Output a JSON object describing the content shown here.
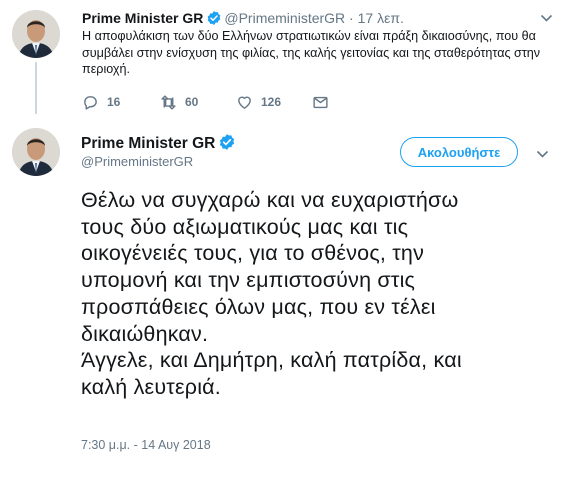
{
  "parent_tweet": {
    "author_name": "Prime Minister GR",
    "handle": "@PrimeministerGR",
    "separator": "·",
    "time": "17 λεπ.",
    "text": "Η αποφυλάκιση των δύο Ελλήνων στρατιωτικών είναι πράξη δικαιοσύνης, που θα συμβάλει στην ενίσχυση της φιλίας, της καλής γειτονίας και της σταθερότητας στην περιοχή.",
    "actions": {
      "reply_count": "16",
      "retweet_count": "60",
      "like_count": "126"
    },
    "icons": [
      "reply-icon",
      "retweet-icon",
      "heart-icon",
      "envelope-icon",
      "chevron-down-icon",
      "verified-badge-icon"
    ]
  },
  "main_tweet": {
    "author_name": "Prime Minister GR",
    "handle": "@PrimeministerGR",
    "follow_label": "Ακολουθήστε",
    "text_lines": [
      "Θέλω να συγχαρώ και να ευχαριστήσω",
      "τους δύο αξιωματικούς μας και τις",
      "οικογένειές τους, για το σθένος, την",
      "υπομονή και την εμπιστοσύνη στις",
      "προσπάθειες όλων μας, που εν τέλει",
      "δικαιώθηκαν.",
      "Άγγελε, και Δημήτρη, καλή πατρίδα, και",
      "καλή λευτεριά."
    ],
    "timestamp": "7:30 μ.μ. - 14 Αυγ 2018"
  },
  "colors": {
    "accent": "#1da1f2",
    "muted": "#657786",
    "text": "#14171a",
    "thread_line": "#ccd6dd"
  }
}
